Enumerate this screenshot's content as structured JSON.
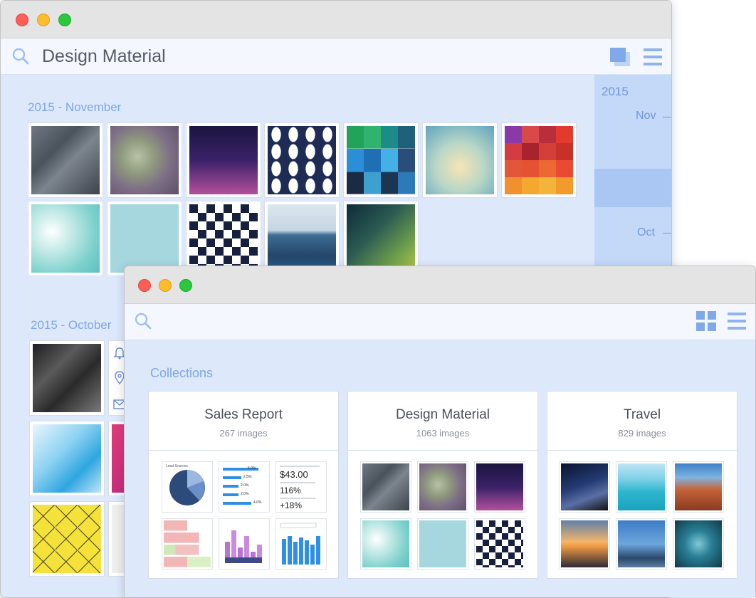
{
  "back_window": {
    "search_title": "Design Material",
    "sections": [
      {
        "label": "2015 - November"
      },
      {
        "label": "2015 - October"
      }
    ],
    "timeline": {
      "year": "2015",
      "months": [
        "Nov",
        "Oct"
      ]
    }
  },
  "front_window": {
    "section_label": "Collections",
    "collections": [
      {
        "title": "Sales Report",
        "count": "267 images"
      },
      {
        "title": "Design Material",
        "count": "1063 images"
      },
      {
        "title": "Travel",
        "count": "829 images"
      }
    ],
    "sales_report_thumbs": {
      "pie_caption": "Lead Sources",
      "price_value": "$43.00",
      "percent_1": "116%",
      "percent_2": "+18%",
      "bar_values": [
        "5.0%",
        "2.5%",
        "2.0%",
        "2.0%",
        "4.0%"
      ]
    }
  },
  "colors": {
    "window_bg": "#dde9fb",
    "accent": "#7ea6e6",
    "timeline_bg": "#c4d8f8"
  }
}
